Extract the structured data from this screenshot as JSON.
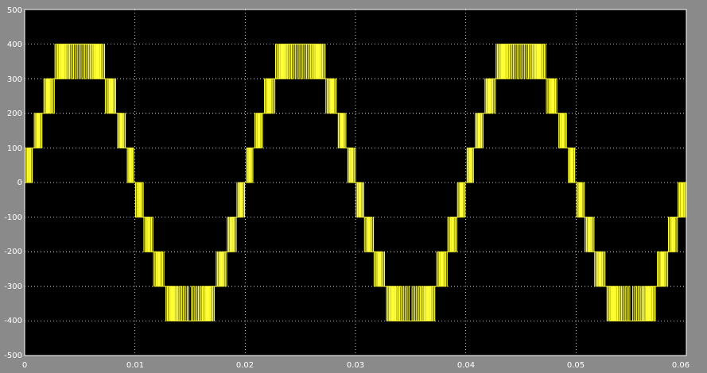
{
  "chart_data": {
    "type": "line",
    "title": "",
    "xlabel": "",
    "ylabel": "",
    "xlim": [
      0,
      0.06
    ],
    "ylim": [
      -500,
      500
    ],
    "x_ticks": [
      "0",
      "0.01",
      "0.02",
      "0.03",
      "0.04",
      "0.05",
      "0.06"
    ],
    "y_ticks": [
      "500",
      "400",
      "300",
      "200",
      "100",
      "0",
      "-100",
      "-200",
      "-300",
      "-400",
      "-500"
    ],
    "grid": true,
    "series": [
      {
        "style": "multilevel PWM waveform (levels 0, ±100, ±200, ±300, ±400)",
        "frequency_hz": 50,
        "amplitude": 400,
        "level_step": 100
      }
    ],
    "colors": {
      "trace": "#ffff33",
      "plot_background": "#000000",
      "frame_background": "#8a8a8a",
      "grid": "#ffffff",
      "text": "#ffffff"
    }
  }
}
